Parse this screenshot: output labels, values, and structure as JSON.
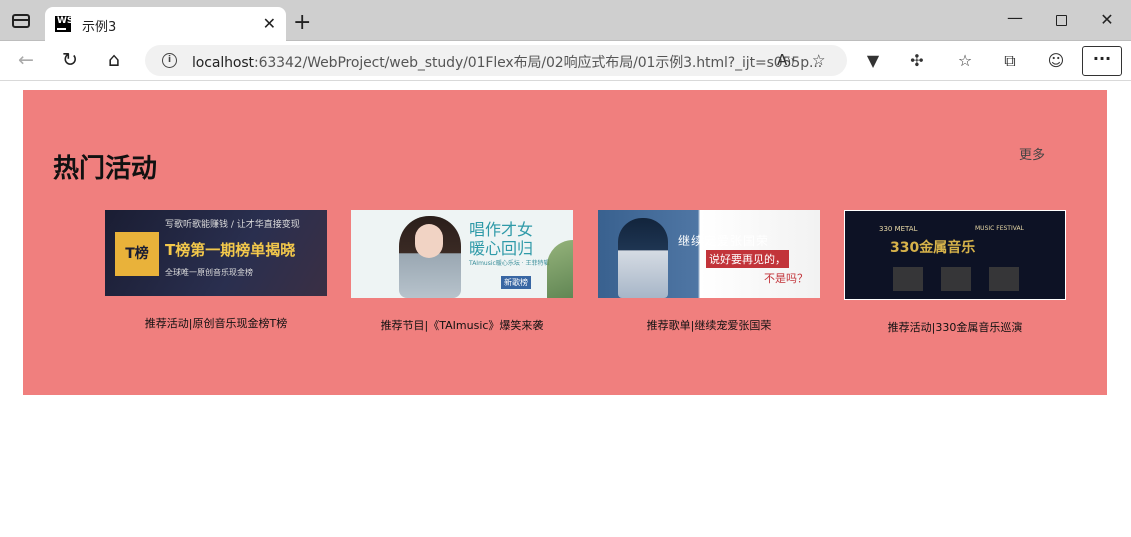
{
  "browser": {
    "tab_title": "示例3",
    "favicon_text": "WS",
    "url_host": "localhost",
    "url_rest": ":63342/WebProject/web_study/01Flex布局/02响应式布局/01示例3.html?_ijt=s055p..."
  },
  "page": {
    "section_title": "热门活动",
    "more_label": "更多",
    "background_color": "#f07f7e",
    "cards": [
      {
        "caption": "推荐活动|原创音乐现金榜T榜",
        "banner_top": "写歌听歌能赚钱 / 让才华直接变现",
        "banner_main": "T榜第一期榜单揭晓",
        "banner_sub": "全球唯一原创音乐现金榜",
        "banner_logo": "T榜"
      },
      {
        "caption": "推荐节目|《TAImusic》爆笑来袭",
        "banner_main_1": "唱作才女",
        "banner_main_2": "暖心回归",
        "banner_sub": "TAImusic暖心乐坛 · 王菲特辑",
        "banner_badge": "新歌榜"
      },
      {
        "caption": "推荐歌单|继续宠爱张国荣",
        "banner_main": "继续宠爱张国荣",
        "banner_line_2": "说好要再见的，",
        "banner_line_3": "不是吗？"
      },
      {
        "caption": "推荐活动|330金属音乐巡演",
        "banner_top": "330 METAL",
        "banner_tag": "MUSIC FESTIVAL",
        "banner_main": "330金属音乐"
      }
    ]
  }
}
